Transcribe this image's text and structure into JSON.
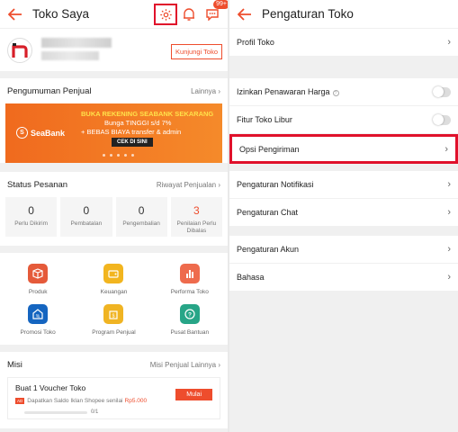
{
  "left": {
    "title": "Toko Saya",
    "notification_badge": "99+",
    "visit_button": "Kunjungi Toko",
    "announcement": {
      "title": "Pengumuman Penjual",
      "more": "Lainnya",
      "banner": {
        "brand": "SeaBank",
        "line1": "BUKA REKENING SEABANK SEKARANG",
        "line2": "Bunga TINGGI s/d 7%",
        "line3": "+ BEBAS BIAYA transfer & admin",
        "cta": "CEK DI SINI"
      }
    },
    "order_status": {
      "title": "Status Pesanan",
      "more": "Riwayat Penjualan",
      "items": [
        {
          "count": "0",
          "label": "Perlu Dikirim"
        },
        {
          "count": "0",
          "label": "Pembatalan"
        },
        {
          "count": "0",
          "label": "Pengembalian"
        },
        {
          "count": "3",
          "label": "Penilaian Perlu Dibalas"
        }
      ]
    },
    "menu": [
      {
        "label": "Produk",
        "icon": "box-icon",
        "color": "#e55a3a"
      },
      {
        "label": "Keuangan",
        "icon": "wallet-icon",
        "color": "#f2b51f"
      },
      {
        "label": "Performa Toko",
        "icon": "bar-chart-icon",
        "color": "#ee6b4d"
      },
      {
        "label": "Promosi Toko",
        "icon": "promo-icon",
        "color": "#1565c0"
      },
      {
        "label": "Program Penjual",
        "icon": "program-icon",
        "color": "#f0b423"
      },
      {
        "label": "Pusat Bantuan",
        "icon": "help-icon",
        "color": "#27a587"
      }
    ],
    "mission": {
      "title": "Misi",
      "more": "Misi Penjual Lainnya",
      "card_title": "Buat 1 Voucher Toko",
      "desc": "Dapatkan Saldo Iklan Shopee senilai",
      "amount": "Rp5.000",
      "button": "Mulai",
      "progress_text": "0/1",
      "progress": 0
    }
  },
  "right": {
    "title": "Pengaturan Toko",
    "items": [
      {
        "label": "Profil Toko"
      },
      {
        "label": "Izinkan Penawaran Harga"
      },
      {
        "label": "Fitur Toko Libur"
      },
      {
        "label": "Opsi Pengiriman"
      },
      {
        "label": "Pengaturan Notifikasi"
      },
      {
        "label": "Pengaturan Chat"
      },
      {
        "label": "Pengaturan Akun"
      },
      {
        "label": "Bahasa"
      }
    ]
  },
  "colors": {
    "accent": "#ee4d2d",
    "highlight": "#e0112b"
  }
}
